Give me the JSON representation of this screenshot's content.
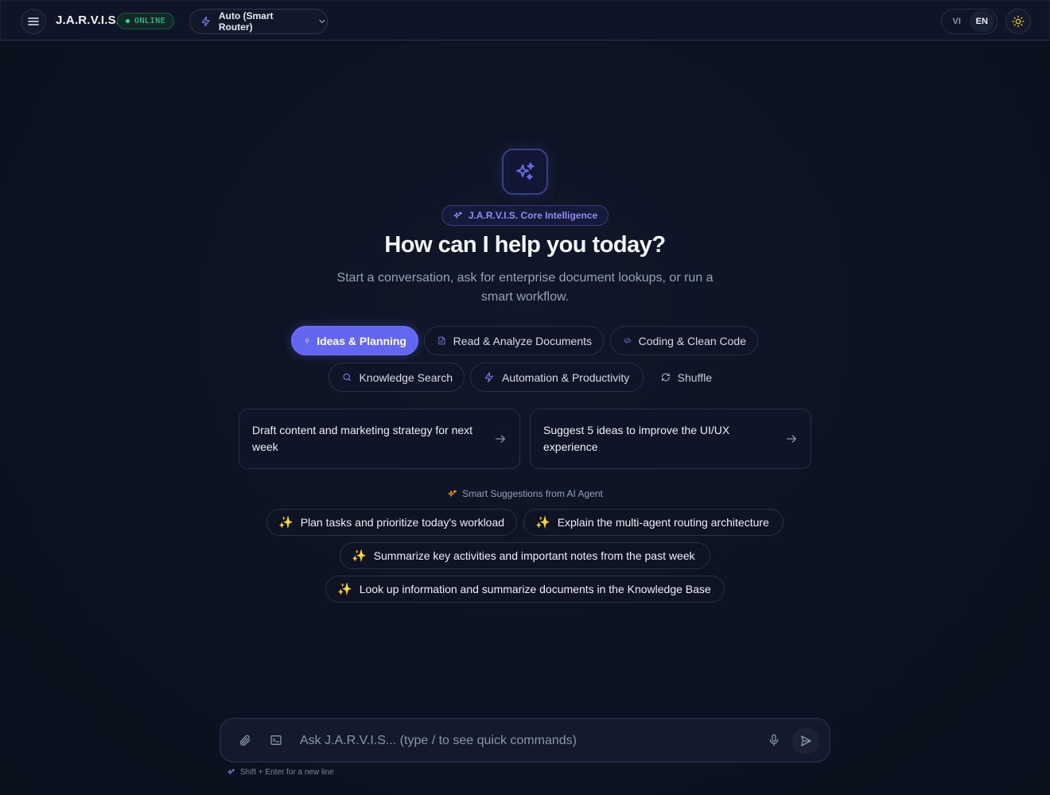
{
  "header": {
    "brand": "J.A.R.V.I.S.",
    "status": "ONLINE",
    "router_label": "Auto (Smart Router)",
    "languages": [
      "VI",
      "EN"
    ],
    "active_language": "EN"
  },
  "hero": {
    "badge": "J.A.R.V.I.S. Core Intelligence",
    "headline": "How can I help you today?",
    "subline": "Start a conversation, ask for enterprise document lookups, or run a smart workflow."
  },
  "categories": [
    {
      "label": "Ideas & Planning",
      "icon": "lightbulb-icon",
      "active": true
    },
    {
      "label": "Read & Analyze Documents",
      "icon": "document-icon",
      "active": false
    },
    {
      "label": "Coding & Clean Code",
      "icon": "code-icon",
      "active": false
    },
    {
      "label": "Knowledge Search",
      "icon": "search-icon",
      "active": false
    },
    {
      "label": "Automation & Productivity",
      "icon": "lightning-icon",
      "active": false
    },
    {
      "label": "Shuffle",
      "icon": "refresh-icon",
      "active": false
    }
  ],
  "prompt_cards": [
    "Draft content and marketing strategy for next week",
    "Suggest 5 ideas to improve the UI/UX experience"
  ],
  "smart_suggestions": {
    "label": "Smart Suggestions from AI Agent",
    "items": [
      "Plan tasks and prioritize today's workload",
      "Explain the multi-agent routing architecture",
      "Summarize key activities and important notes from the past week",
      "Look up information and summarize documents in the Knowledge Base"
    ]
  },
  "composer": {
    "placeholder": "Ask J.A.R.V.I.S... (type / to see quick commands)",
    "value": "",
    "hint": "Shift + Enter for a new line"
  },
  "colors": {
    "accent": "#6366f1",
    "online": "#34d399",
    "spark": "#fbbf24",
    "background": "#0d1322"
  }
}
